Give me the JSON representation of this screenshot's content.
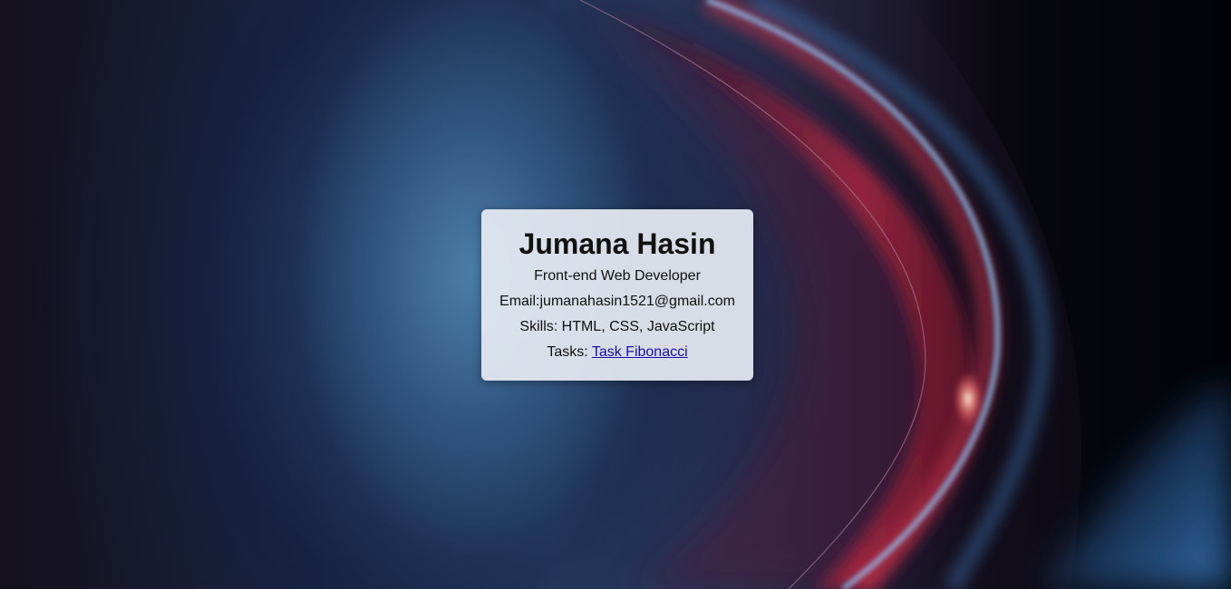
{
  "profile": {
    "name": "Jumana Hasin",
    "role": "Front-end Web Developer",
    "email_line": "Email:jumanahasin1521@gmail.com",
    "skills_line": "Skills: HTML, CSS, JavaScript",
    "tasks_label": "Tasks: ",
    "tasks_link_text": "Task Fibonacci"
  },
  "colors": {
    "card_background": "#e7ecf3",
    "link": "#1a0dab",
    "text": "#111111"
  }
}
